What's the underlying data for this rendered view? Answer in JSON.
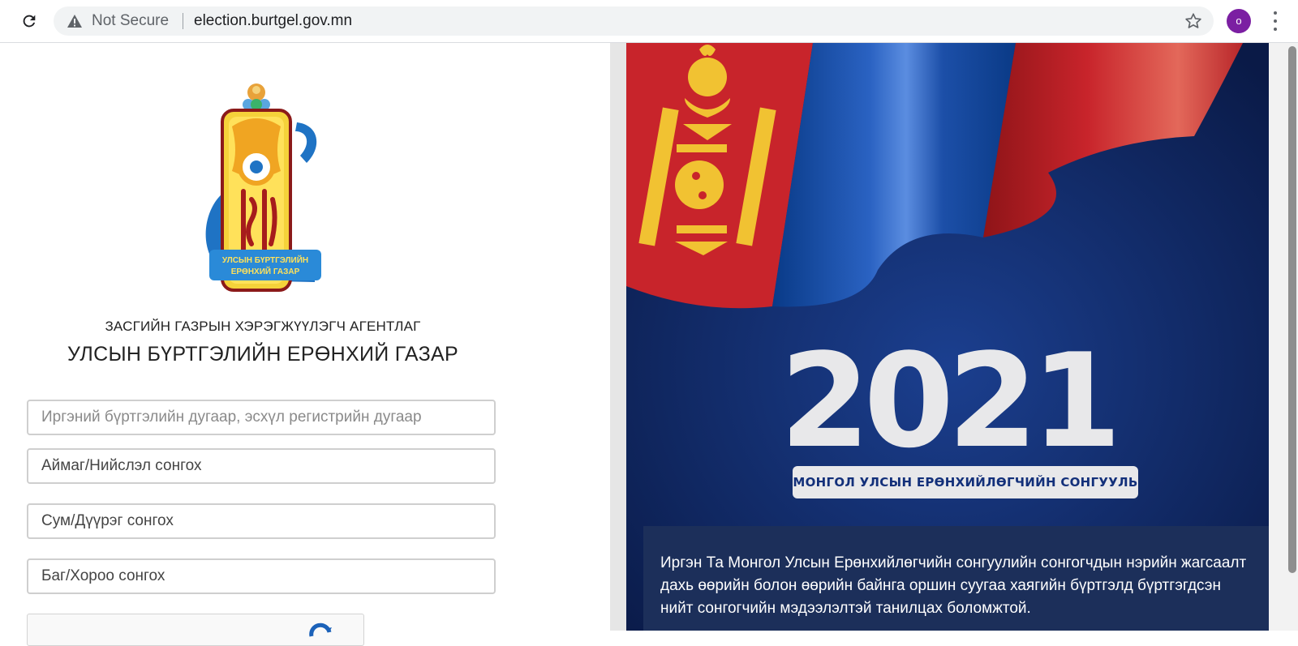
{
  "browser": {
    "security_label": "Not Secure",
    "url": "election.burtgel.gov.mn",
    "profile_initial": "o",
    "colors": {
      "profile": "#7b1fa2"
    }
  },
  "agency": {
    "subtitle": "ЗАСГИЙН ГАЗРЫН ХЭРЭГЖҮҮЛЭГЧ АГЕНТЛАГ",
    "title": "УЛСЫН БҮРТГЭЛИЙН ЕРӨНХИЙ ГАЗАР",
    "logo_ribbon_line1": "УЛСЫН БҮРТГЭЛИЙН",
    "logo_ribbon_line2": "ЕРӨНХИЙ ГАЗАР"
  },
  "form": {
    "id_placeholder": "Иргэний бүртгэлийн дугаар, эсхүл регистрийн дугаар",
    "aimag_select": "Аймаг/Нийслэл сонгох",
    "sum_select": "Сум/Дүүрэг сонгох",
    "bag_select": "Баг/Хороо сонгох"
  },
  "banner": {
    "year": "2021",
    "election_title": "МОНГОЛ УЛСЫН ЕРӨНХИЙЛӨГЧИЙН СОНГУУЛЬ",
    "info_text": "Иргэн Та Монгол Улсын Ерөнхийлөгчийн сонгуулийн сонгогчдын нэрийн жагсаалт дахь өөрийн болон өөрийн байнга оршин суугаа хаягийн бүртгэлд бүртгэгдсэн нийт сонгогчийн мэдээлэлтэй танилцах боломжтой.",
    "colors": {
      "flag_red": "#c8242b",
      "flag_blue": "#0b4fa8",
      "soyombo": "#f1c232",
      "background": "#0d2158"
    }
  }
}
